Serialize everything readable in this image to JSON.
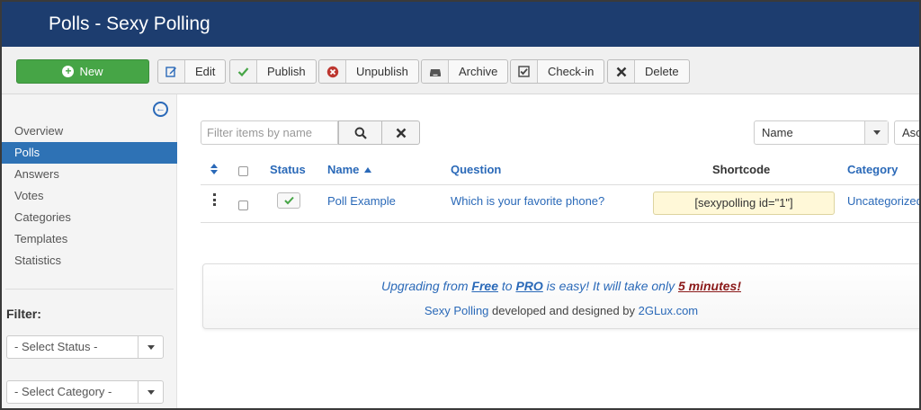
{
  "header": {
    "title": "Polls - Sexy Polling"
  },
  "toolbar": {
    "new_label": "New",
    "edit_label": "Edit",
    "publish_label": "Publish",
    "unpublish_label": "Unpublish",
    "archive_label": "Archive",
    "checkin_label": "Check-in",
    "delete_label": "Delete"
  },
  "sidebar": {
    "items": [
      {
        "label": "Overview",
        "active": false
      },
      {
        "label": "Polls",
        "active": true
      },
      {
        "label": "Answers",
        "active": false
      },
      {
        "label": "Votes",
        "active": false
      },
      {
        "label": "Categories",
        "active": false
      },
      {
        "label": "Templates",
        "active": false
      },
      {
        "label": "Statistics",
        "active": false
      }
    ],
    "filter_label": "Filter:",
    "status_select": "- Select Status -",
    "category_select": "- Select Category -"
  },
  "search": {
    "placeholder": "Filter items by name"
  },
  "sort": {
    "field": "Name",
    "direction": "Asc"
  },
  "table": {
    "headers": {
      "status": "Status",
      "name": "Name",
      "question": "Question",
      "shortcode": "Shortcode",
      "category": "Category"
    },
    "rows": [
      {
        "name": "Poll Example",
        "question": "Which is your favorite phone?",
        "shortcode": "[sexypolling id=\"1\"]",
        "category": "Uncategorized",
        "published": true
      }
    ]
  },
  "promo": {
    "line1_a": "Upgrading from ",
    "line1_free": "Free",
    "line1_b": " to ",
    "line1_pro": "PRO",
    "line1_c": " is easy! It will take only ",
    "line1_time": "5 minutes!",
    "line2_product": "Sexy Polling",
    "line2_mid": " developed and designed by ",
    "line2_company": "2GLux.com"
  },
  "colors": {
    "header_bg": "#1d3d6f",
    "accent": "#2a69b8",
    "new_button": "#46a546",
    "active_nav": "#2e72b5",
    "shortcode_bg": "#fff8d8"
  }
}
